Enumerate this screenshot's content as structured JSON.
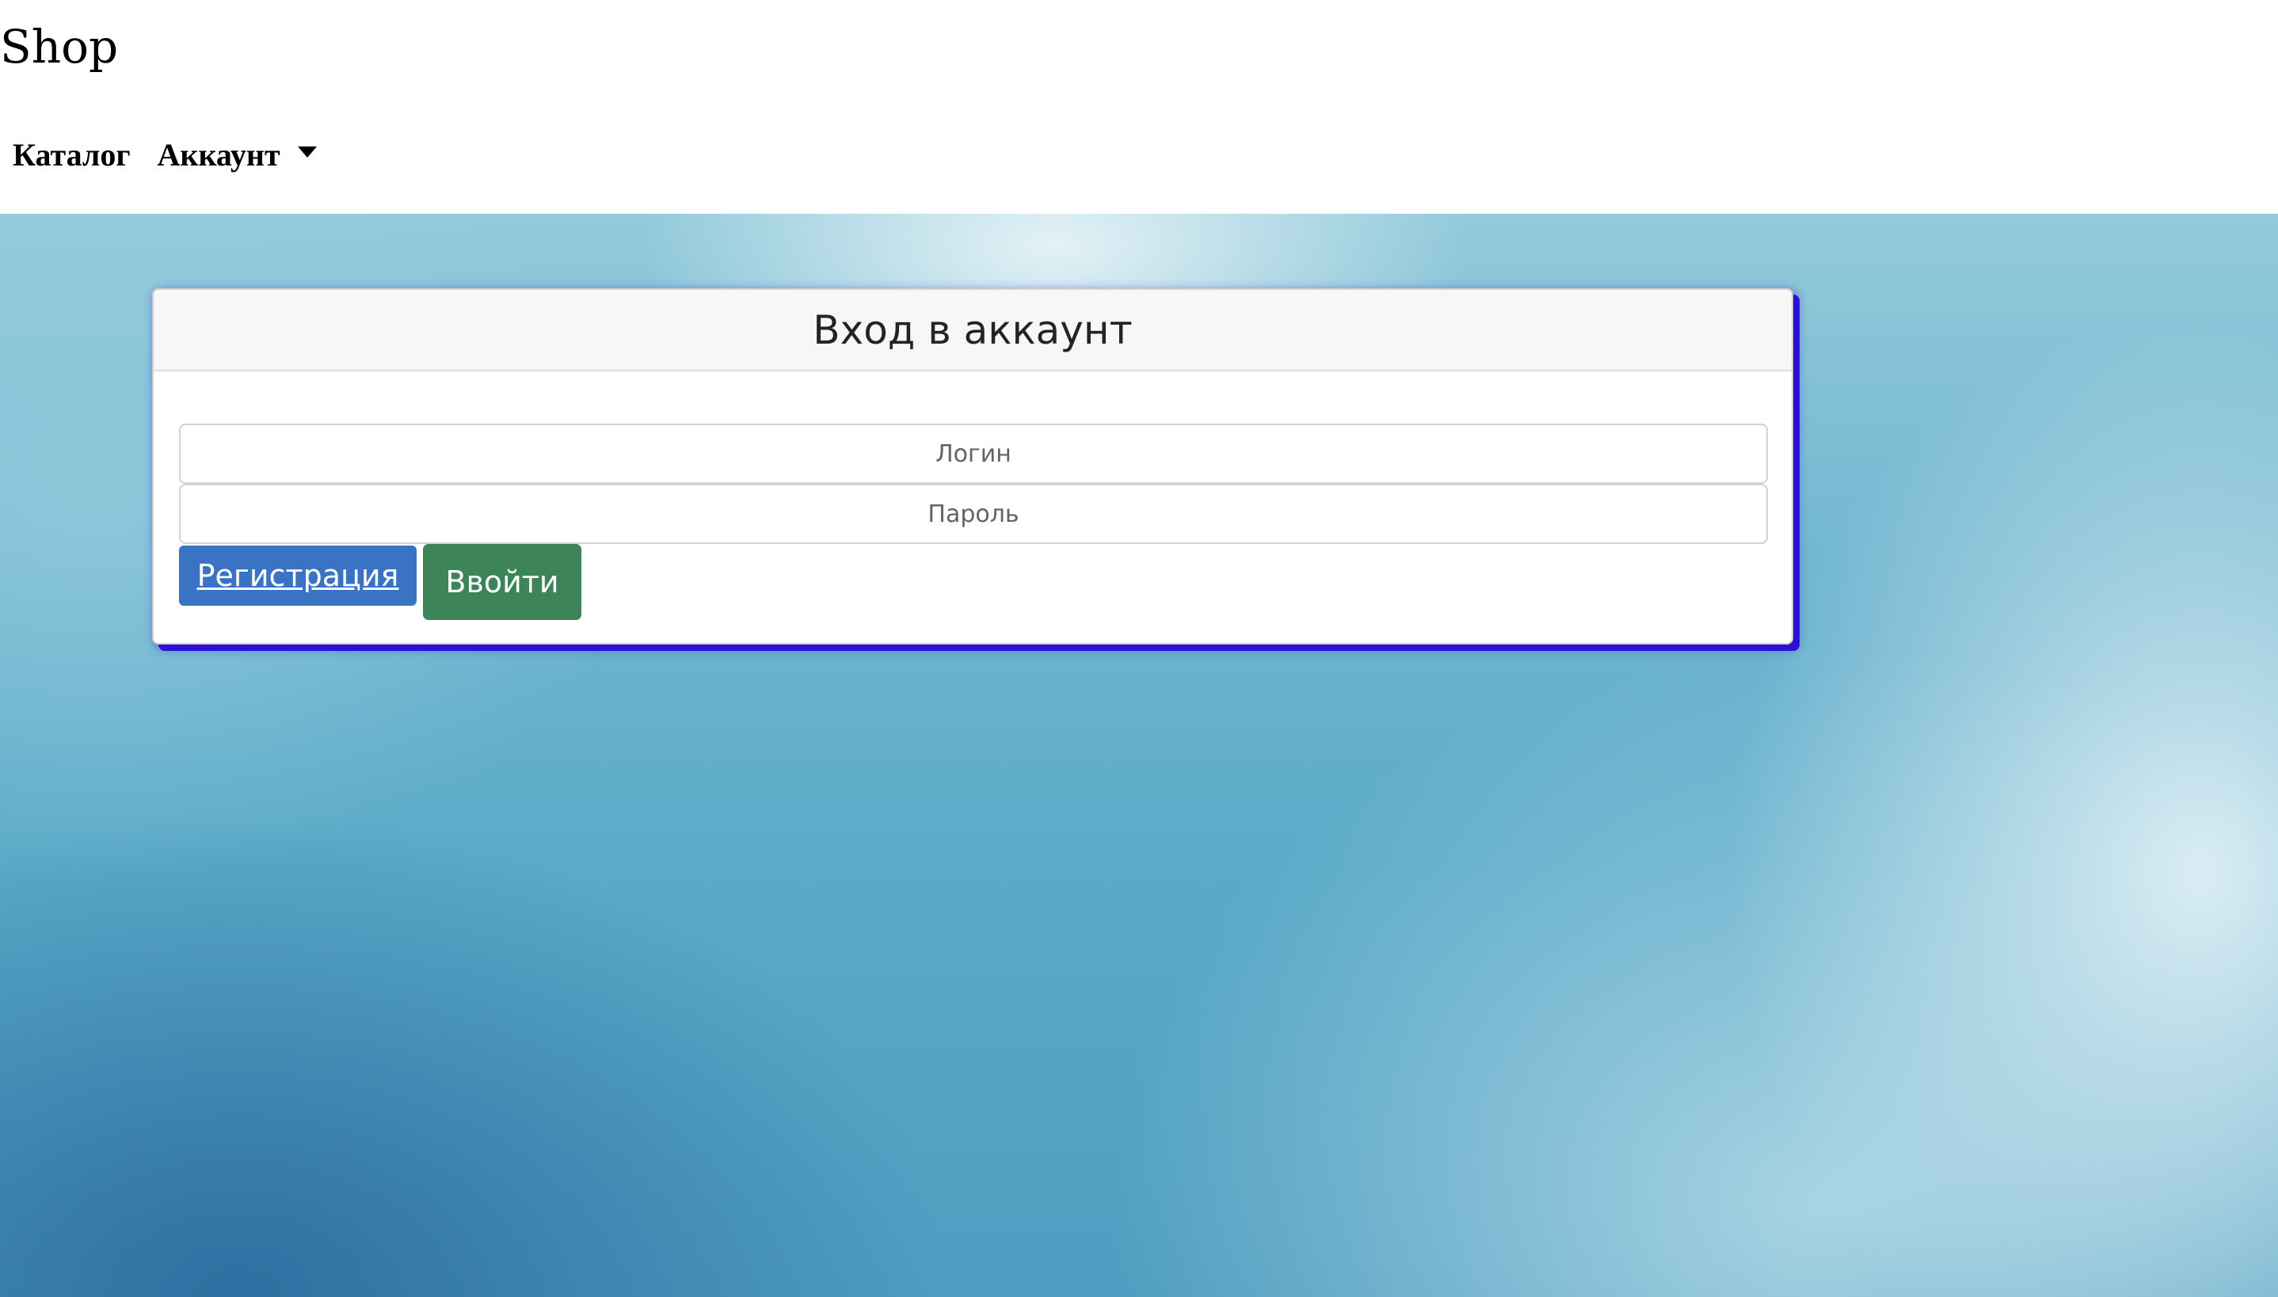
{
  "header": {
    "brand": "Shop",
    "nav": {
      "catalog_label": "Каталог",
      "account_label": "Аккаунт"
    }
  },
  "login_card": {
    "title": "Вход в аккаунт",
    "login_placeholder": "Логин",
    "password_placeholder": "Пароль",
    "register_label": "Регистрация",
    "submit_label": "Ввойти"
  },
  "colors": {
    "card_shadow": "#2a0fd6",
    "register_button": "#3b73c4",
    "login_button": "#3d8558"
  },
  "icons": {
    "account_menu": "caret-down-icon"
  }
}
